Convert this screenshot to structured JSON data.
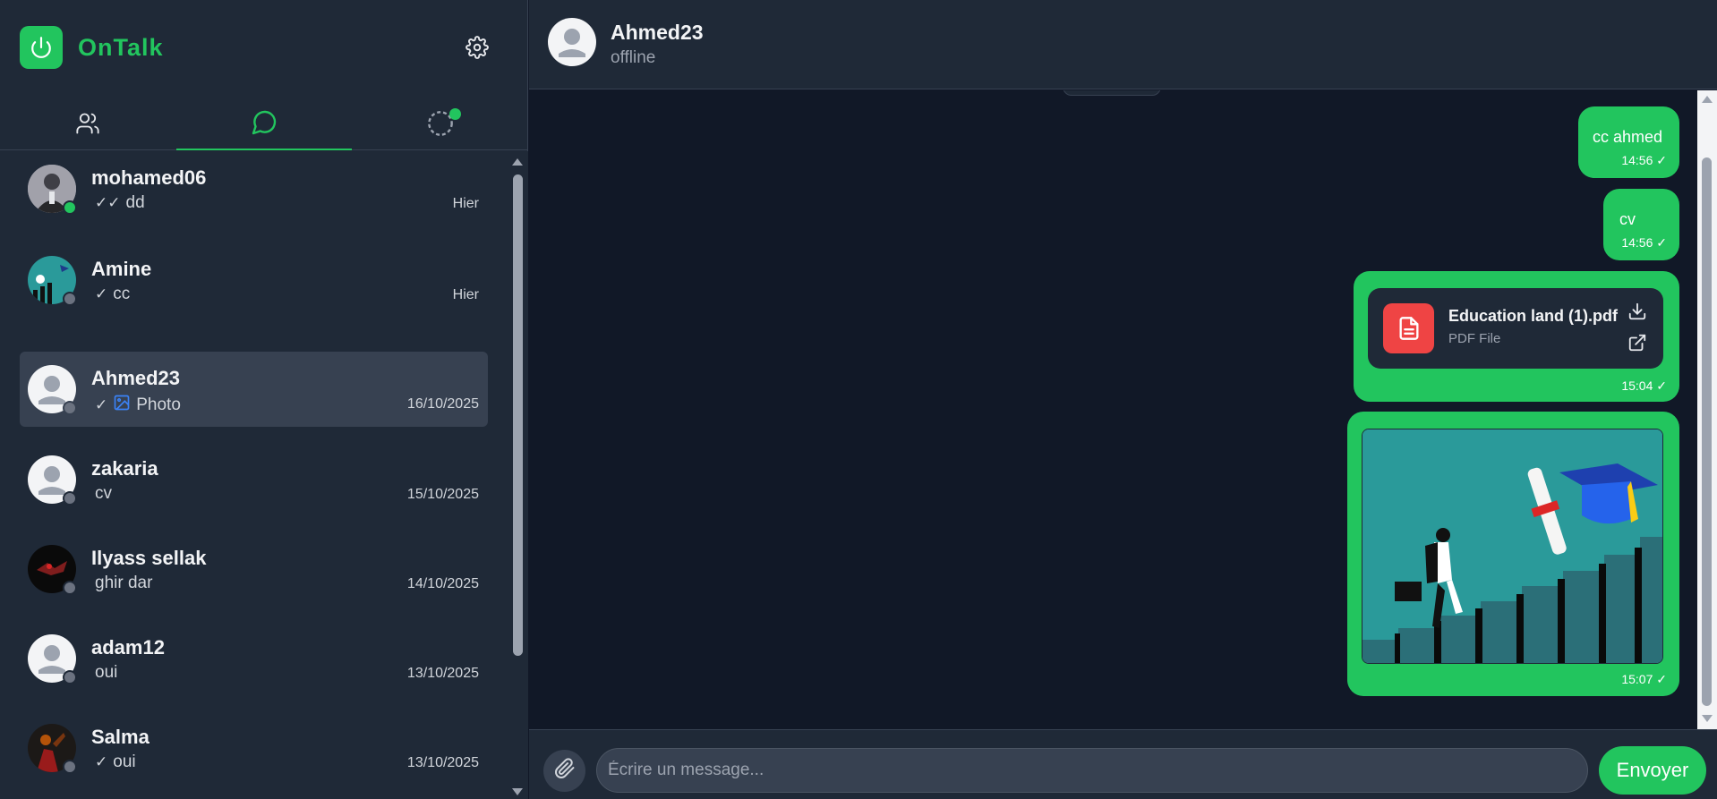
{
  "app": {
    "name": "OnTalk"
  },
  "colors": {
    "accent": "#22c55e",
    "sidebar_bg": "#1f2937",
    "chat_bg": "#111827",
    "pdf_icon": "#ef4444"
  },
  "icons": {
    "logo": "power-icon",
    "settings": "gear-icon",
    "tab_contacts": "users-icon",
    "tab_chats": "message-circle-icon",
    "tab_status": "status-circle-icon",
    "attach": "paperclip-icon",
    "photo": "image-icon",
    "pdf": "file-text-icon",
    "download": "download-icon",
    "open": "external-link-icon"
  },
  "tabs": {
    "active": "chats"
  },
  "conversations": [
    {
      "name": "mohamed06",
      "ticks": "✓✓",
      "preview": "dd",
      "time": "Hier",
      "status": "online",
      "avatar": "photo"
    },
    {
      "name": "Amine",
      "ticks": "✓",
      "preview": "cc",
      "time": "Hier",
      "status": "offline",
      "avatar": "photo"
    },
    {
      "name": "Ahmed23",
      "ticks": "✓",
      "preview": "Photo",
      "time": "16/10/2025",
      "status": "offline",
      "avatar": "default",
      "active": true
    },
    {
      "name": "zakaria",
      "ticks": "",
      "preview": "cv",
      "time": "15/10/2025",
      "status": "offline",
      "avatar": "default"
    },
    {
      "name": "Ilyass sellak",
      "ticks": "",
      "preview": "ghir dar",
      "time": "14/10/2025",
      "status": "offline",
      "avatar": "photo"
    },
    {
      "name": "adam12",
      "ticks": "",
      "preview": "oui",
      "time": "13/10/2025",
      "status": "offline",
      "avatar": "default"
    },
    {
      "name": "Salma",
      "ticks": "✓",
      "preview": "oui",
      "time": "13/10/2025",
      "status": "offline",
      "avatar": "photo"
    }
  ],
  "chat": {
    "name": "Ahmed23",
    "status": "offline",
    "messages": [
      {
        "type": "text",
        "text": "cc ahmed",
        "time": "14:56 ✓"
      },
      {
        "type": "text",
        "text": "cv",
        "time": "14:56 ✓"
      },
      {
        "type": "file",
        "file_name": "Education land (1).pdf",
        "file_type": "PDF File",
        "time": "15:04 ✓"
      },
      {
        "type": "image",
        "time": "15:07 ✓"
      }
    ]
  },
  "composer": {
    "placeholder": "Écrire un message...",
    "value": "",
    "send_label": "Envoyer"
  }
}
